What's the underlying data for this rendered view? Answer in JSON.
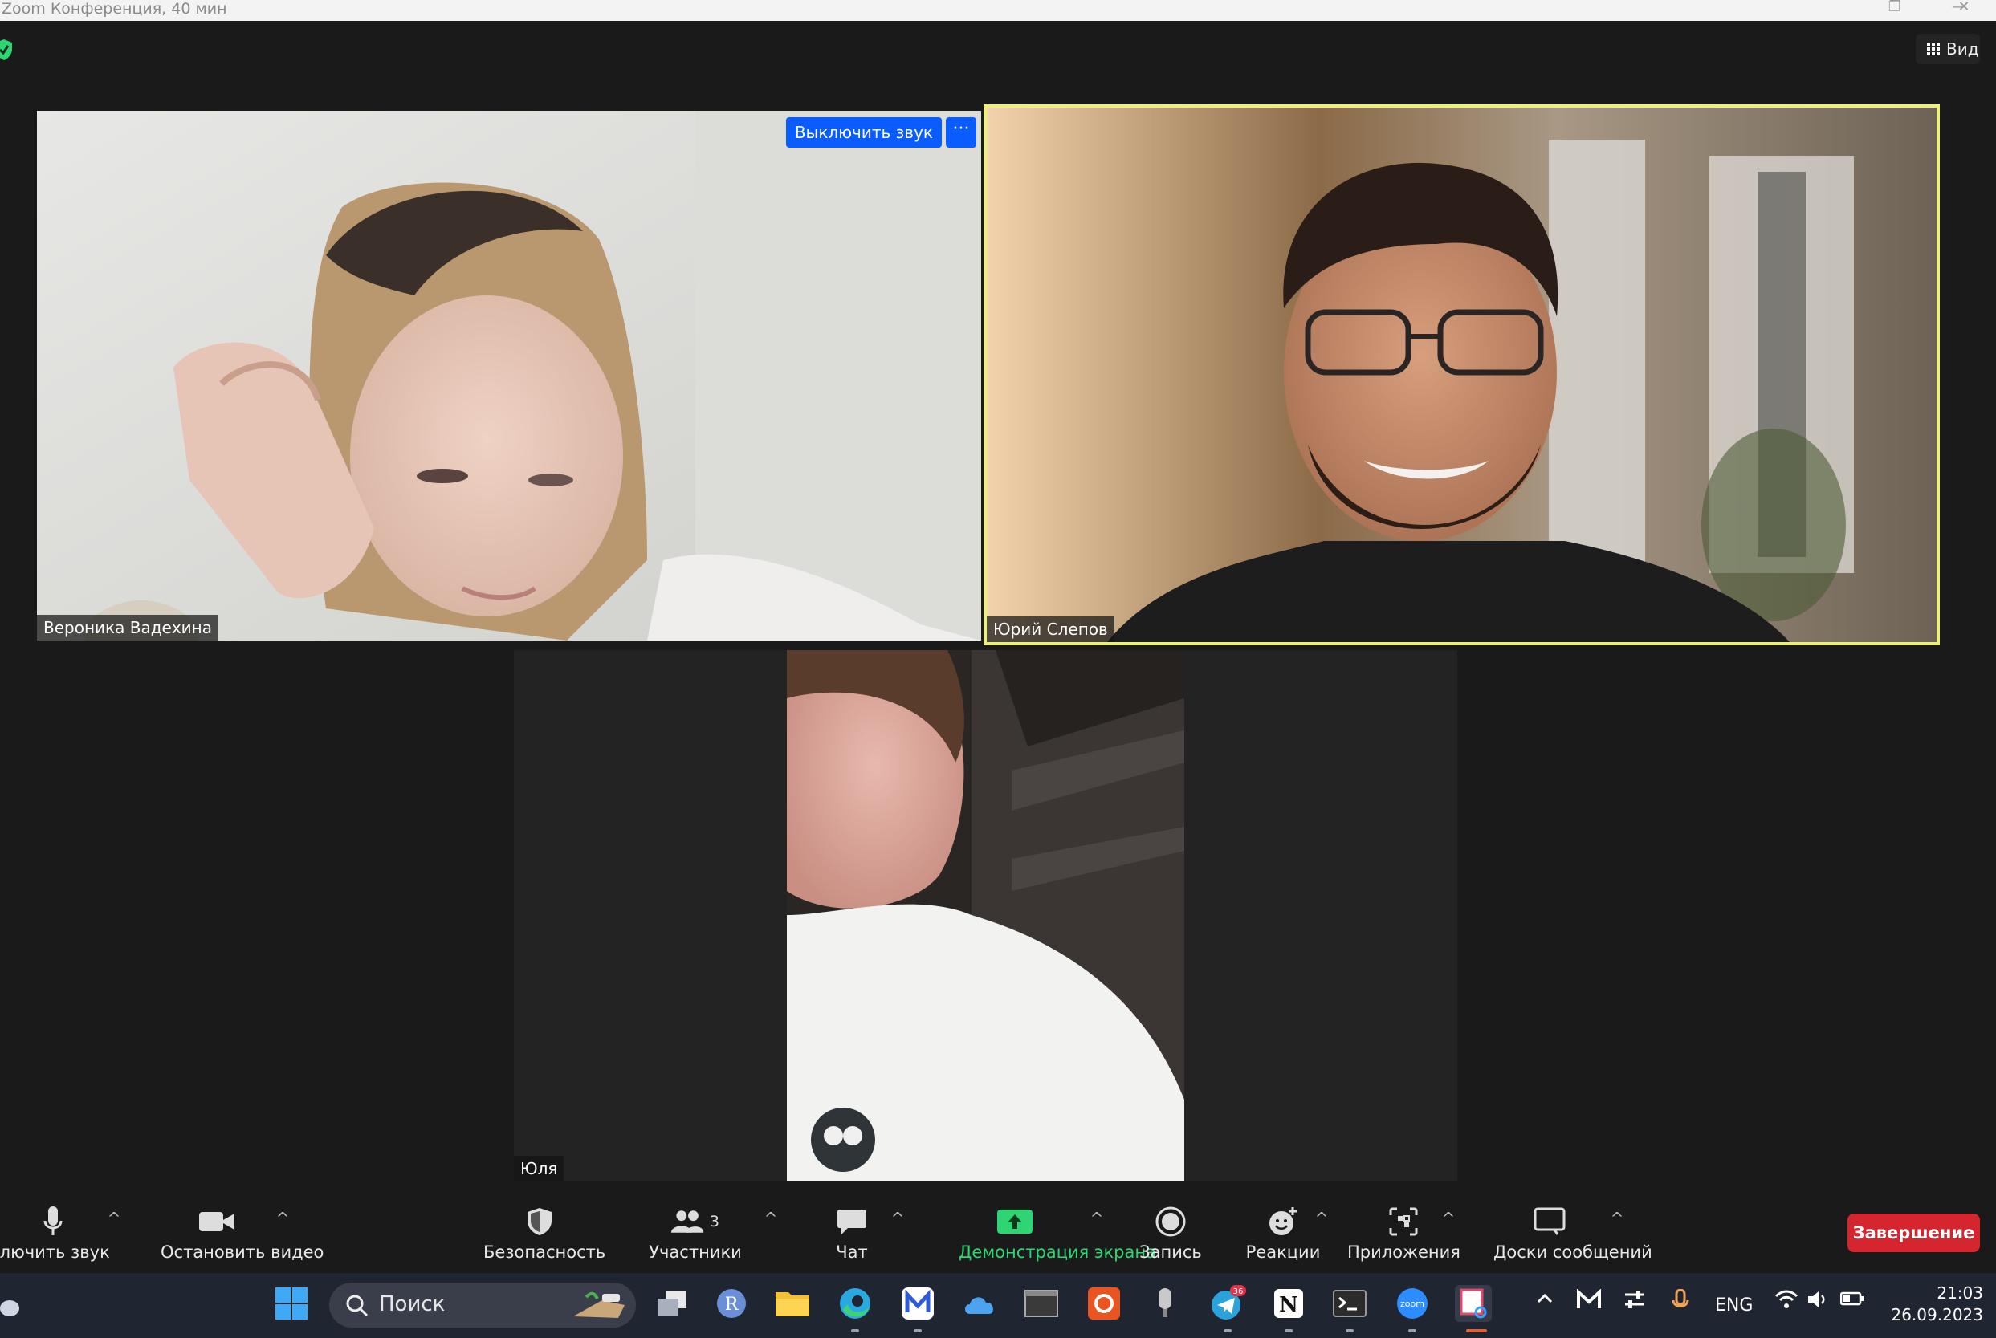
{
  "window": {
    "title": "Zoom Конференция, 40 мин",
    "min_glyph": "—",
    "restore_glyph": "❐",
    "close_glyph": "✕"
  },
  "meeting": {
    "view_label": "Вид",
    "security_badge_color": "#2ed573",
    "active_speaker_color": "#e9f07e",
    "participants": [
      {
        "name": "Вероника Вадехина",
        "mute_label": "Выключить звук",
        "more_label": "···"
      },
      {
        "name": "Юрий Слепов"
      },
      {
        "name": "Юля"
      }
    ]
  },
  "controls": {
    "mute_label": "Выключить звук",
    "video_label": "Остановить видео",
    "security_label": "Безопасность",
    "participants_label": "Участники",
    "participants_count": "3",
    "chat_label": "Чат",
    "share_label": "Демонстрация экрана",
    "record_label": "Запись",
    "reactions_label": "Реакции",
    "apps_label": "Приложения",
    "whiteboard_label": "Доски сообщений",
    "end_label": "Завершение",
    "caret": "^",
    "accent_green": "#2ed573",
    "end_color": "#d5262f"
  },
  "taskbar": {
    "search_placeholder": "Поиск",
    "telegram_badge": "36",
    "r_letter": "R",
    "zoom_text": "zoom",
    "notion_letter": "N",
    "lang": "ENG",
    "time": "21:03",
    "date": "26.09.2023"
  }
}
